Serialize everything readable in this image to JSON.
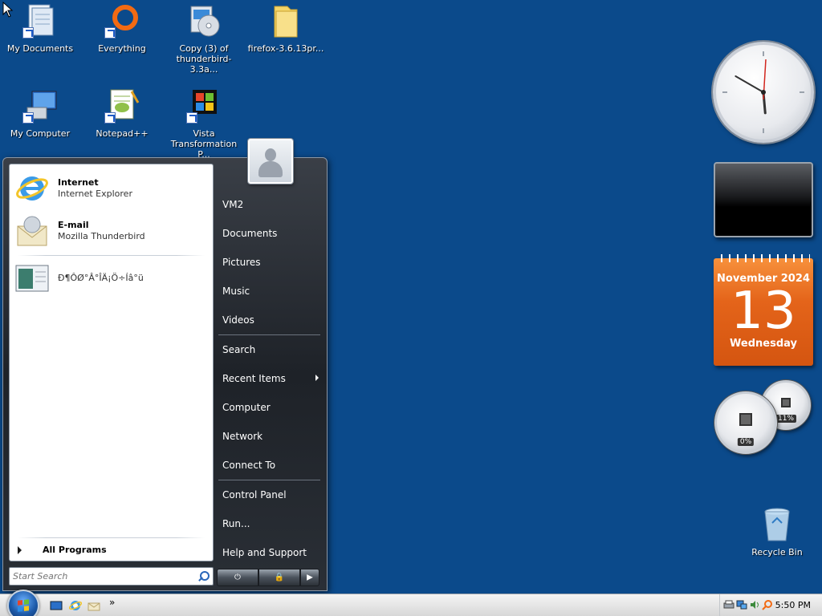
{
  "desktop": {
    "icons": [
      {
        "label": "My Documents",
        "icon": "my-documents-icon"
      },
      {
        "label": "Everything",
        "icon": "everything-search-icon"
      },
      {
        "label": "Copy (3) of thunderbird-3.3a...",
        "icon": "installer-cd-icon"
      },
      {
        "label": "firefox-3.6.13pr...",
        "icon": "folder-icon"
      },
      {
        "label": "My Computer",
        "icon": "my-computer-icon"
      },
      {
        "label": "Notepad++",
        "icon": "notepad-plus-plus-icon"
      },
      {
        "label": "Vista Transformation P...",
        "icon": "vista-transformation-icon"
      },
      {
        "label": "Recycle Bin",
        "icon": "recycle-bin-icon"
      }
    ]
  },
  "sidebar": {
    "calendar": {
      "month": "November 2024",
      "day": "13",
      "weekday": "Wednesday"
    },
    "meters": {
      "cpu": "0%",
      "memory": "11%"
    },
    "clock": {
      "hour": 5,
      "minute": 50
    }
  },
  "start_menu": {
    "pinned": [
      {
        "title": "Internet",
        "subtitle": "Internet Explorer",
        "icon": "internet-explorer-icon"
      },
      {
        "title": "E-mail",
        "subtitle": "Mozilla Thunderbird",
        "icon": "thunderbird-mail-icon"
      }
    ],
    "recent": [
      {
        "title": "Ð¶ÔØ°Â°ÎÄ¡Ö÷Íâ°ü",
        "icon": "window-app-icon"
      }
    ],
    "all_programs": "All Programs",
    "search_placeholder": "Start Search",
    "right_items": [
      {
        "label": "VM2",
        "separator_after": false
      },
      {
        "label": "Documents",
        "separator_after": false
      },
      {
        "label": "Pictures",
        "separator_after": false
      },
      {
        "label": "Music",
        "separator_after": false
      },
      {
        "label": "Videos",
        "separator_after": true
      },
      {
        "label": "Search",
        "separator_after": false
      },
      {
        "label": "Recent Items",
        "separator_after": false,
        "submenu": true
      },
      {
        "label": "Computer",
        "separator_after": false
      },
      {
        "label": "Network",
        "separator_after": false
      },
      {
        "label": "Connect To",
        "separator_after": true
      },
      {
        "label": "Control Panel",
        "separator_after": false
      },
      {
        "label": "Run...",
        "separator_after": false
      },
      {
        "label": "Help and Support",
        "separator_after": false
      }
    ]
  },
  "taskbar": {
    "quick_launch": [
      "show-desktop-icon",
      "internet-explorer-icon",
      "thunderbird-mail-icon"
    ],
    "overflow": "»",
    "time": "5:50 PM"
  }
}
